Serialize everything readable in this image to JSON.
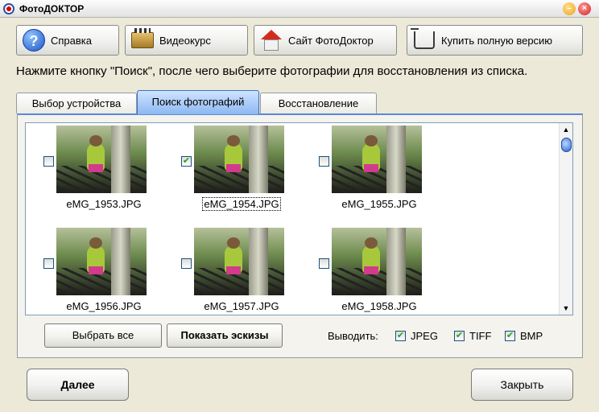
{
  "window": {
    "title": "ФотоДОКТОР"
  },
  "toolbar": {
    "help": "Справка",
    "video": "Видеокурс",
    "site": "Сайт ФотоДоктор",
    "buy": "Купить полную версию"
  },
  "instruction": "Нажмите кнопку \"Поиск\", после чего выберите фотографии для восстановления из списка.",
  "tabs": [
    {
      "label": "Выбор устройства"
    },
    {
      "label": "Поиск фотографий"
    },
    {
      "label": "Восстановление"
    }
  ],
  "files": [
    {
      "name": "eMG_1953.JPG",
      "checked": false
    },
    {
      "name": "eMG_1954.JPG",
      "checked": true
    },
    {
      "name": "eMG_1955.JPG",
      "checked": false
    },
    {
      "name": "eMG_1956.JPG",
      "checked": false
    },
    {
      "name": "eMG_1957.JPG",
      "checked": false
    },
    {
      "name": "eMG_1958.JPG",
      "checked": false
    }
  ],
  "actions": {
    "select_all": "Выбрать все",
    "show_thumbs": "Показать эскизы",
    "output_label": "Выводить:"
  },
  "formats": [
    {
      "label": "JPEG",
      "checked": true
    },
    {
      "label": "TIFF",
      "checked": true
    },
    {
      "label": "BMP",
      "checked": true
    }
  ],
  "footer": {
    "next": "Далее",
    "close": "Закрыть"
  },
  "glyphs": {
    "check": "✔",
    "up": "▲",
    "down": "▼",
    "minimize": "–",
    "close": "×",
    "question": "?"
  }
}
